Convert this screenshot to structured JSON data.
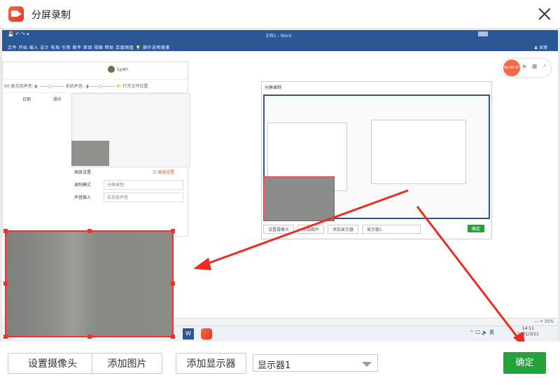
{
  "window": {
    "title": "分屏录制",
    "close_icon": "close-icon"
  },
  "preview": {
    "ribbon": {
      "quick_access": "💾 ↶ ↷ ▾",
      "doc_title": "文档1 - Word",
      "menu": "文件   开始   插入   设计   布局   引用   邮件   审阅   视图   帮助   百度网盘   💡 操作说明搜索",
      "share": "♟ 共享"
    },
    "recorder_widget": {
      "time": "00:00:00",
      "controls": "▶ ■ ↗"
    },
    "status": {
      "zoom": "— + 35%"
    },
    "taskbar": {
      "word": "W",
      "tray": "⌃ 🖵 🔈 英",
      "time": "14:11",
      "date": "2021/3/11"
    },
    "left_window": {
      "user": "Lyan",
      "toolbar": "00   麦克风声音: ◐ ——○———   系统声音: ◑ ——○———   📁 打开文件位置",
      "col_date": "日期",
      "col_action": "操作",
      "advanced": "高级设置",
      "advanced_right": "☰ 高级设置",
      "record_mode_label": "录制模式",
      "record_mode_value": "分屏录制",
      "audio_label": "声音输入",
      "audio_value": "仅系统声音"
    },
    "right_window": {
      "title": "分屏录制",
      "btn_camera": "设置摄像头",
      "btn_image": "添加图片",
      "btn_display": "添加显示器",
      "display": "显示器1",
      "ok": "确定"
    }
  },
  "bottom": {
    "set_camera": "设置摄像头",
    "add_image": "添加图片",
    "add_display": "添加显示器",
    "display_select": "显示器1",
    "confirm": "确定"
  },
  "colors": {
    "accent_green": "#23a33b",
    "selection_red": "#e8362c",
    "word_blue": "#2b5797"
  }
}
